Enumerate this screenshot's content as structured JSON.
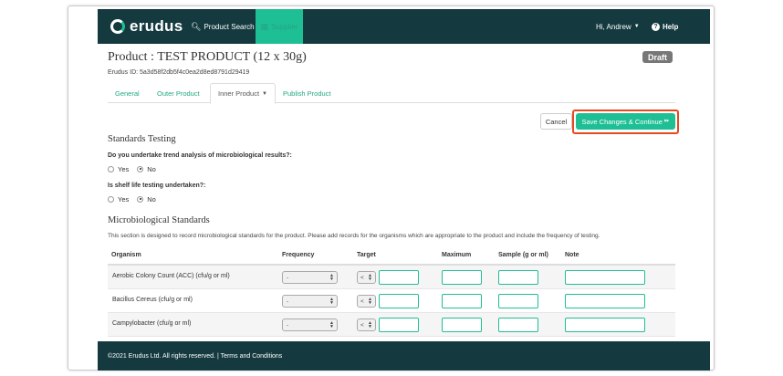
{
  "brand": {
    "name": "erudus"
  },
  "nav": {
    "product_search": "Product Search",
    "supplier": "Supplier",
    "user": "Hi, Andrew",
    "help": "Help"
  },
  "product": {
    "title": "Product : TEST PRODUCT (12 x 30g)",
    "status": "Draft",
    "erudus_id": "Erudus ID: 5a3d58f2db5f4c0ea2d8ed8791d29419"
  },
  "tabs": [
    {
      "label": "General"
    },
    {
      "label": "Outer Product"
    },
    {
      "label": "Inner Product"
    },
    {
      "label": "Publish Product"
    }
  ],
  "actions": {
    "cancel": "Cancel",
    "save": "Save Changes & Continue"
  },
  "standards_testing": {
    "title": "Standards Testing",
    "q1": {
      "label": "Do you undertake trend analysis of microbiological results?:",
      "yes": "Yes",
      "no": "No",
      "selected": "No"
    },
    "q2": {
      "label": "Is shelf life testing undertaken?:",
      "yes": "Yes",
      "no": "No",
      "selected": "No"
    }
  },
  "micro": {
    "title": "Microbiological Standards",
    "intro": "This section is designed to record microbiological standards for the product. Please add records for the organisms which are appropriate to the product and include the frequency of testing.",
    "columns": [
      "Organism",
      "Frequency",
      "Target",
      "Maximum",
      "Sample (g or ml)",
      "Note"
    ],
    "rows": [
      {
        "organism": "Aerobic Colony Count (ACC) (cfu/g or ml)",
        "frequency": "-",
        "operator": "<"
      },
      {
        "organism": "Bacillus Cereus (cfu/g or ml)",
        "frequency": "-",
        "operator": "<"
      },
      {
        "organism": "Campylobacter (cfu/g or ml)",
        "frequency": "-",
        "operator": "<"
      },
      {
        "organism": "",
        "frequency": "",
        "operator": ""
      }
    ]
  },
  "footer": {
    "text": "©2021 Erudus Ltd. All rights reserved. | Terms and Conditions"
  },
  "colors": {
    "navbar": "#143a3f",
    "accent": "#1fbf95",
    "highlight": "#e8481f",
    "badge": "#777777"
  }
}
